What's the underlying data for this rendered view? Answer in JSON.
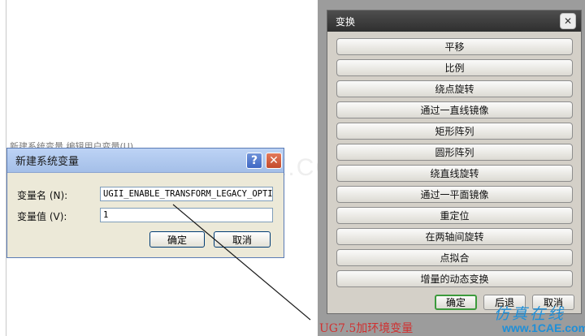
{
  "background": {
    "partial_text": "新建系统变量   编辑用户变量(U)..."
  },
  "watermark": "1CAE.COM",
  "dialog": {
    "title": "新建系统变量",
    "help_glyph": "?",
    "close_glyph": "✕",
    "var_name_label": "变量名 (N):",
    "var_name_value": "UGII_ENABLE_TRANSFORM_LEGACY_OPTION",
    "var_value_label": "变量值 (V):",
    "var_value_value": "1",
    "ok_label": "确定",
    "cancel_label": "取消"
  },
  "transform_panel": {
    "title": "变换",
    "close_glyph": "✕",
    "items": [
      {
        "label": "平移"
      },
      {
        "label": "比例"
      },
      {
        "label": "绕点旋转"
      },
      {
        "label": "通过一直线镜像"
      },
      {
        "label": "矩形阵列"
      },
      {
        "label": "圆形阵列"
      },
      {
        "label": "绕直线旋转"
      },
      {
        "label": "通过一平面镜像"
      },
      {
        "label": "重定位"
      },
      {
        "label": "在两轴间旋转"
      },
      {
        "label": "点拟合"
      },
      {
        "label": "增量的动态变换"
      }
    ],
    "ok_label": "确定",
    "back_label": "后退",
    "cancel_label": "取消"
  },
  "caption": "UG7.5加环境变量",
  "logo": {
    "line1": "仿真在线",
    "line2": "www.1CAE.com"
  },
  "colors": {
    "dialog_title_bar": "#a4bfe8",
    "panel_title_bar": "#2f2f2f",
    "caption": "#d03030",
    "logo": "#1f8fd8",
    "ok_highlight": "#3c9a3c"
  }
}
